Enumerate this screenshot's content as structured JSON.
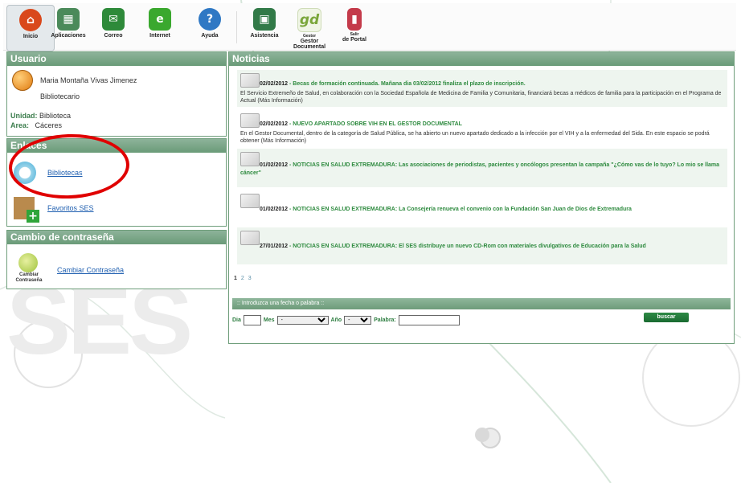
{
  "toolbar": {
    "items": [
      {
        "label": "Inicio",
        "icon": "home-icon",
        "color": "#d9481b"
      },
      {
        "label": "Aplicaciones",
        "icon": "apps-icon",
        "color": "#4b8a5a"
      },
      {
        "label": "Correo",
        "icon": "mail-icon",
        "color": "#2e8a3a"
      },
      {
        "label": "Internet",
        "icon": "internet-icon",
        "color": "#3aa82e"
      },
      {
        "label": "Ayuda",
        "icon": "help-icon",
        "color": "#2f78c4"
      },
      {
        "label": "Asistencia",
        "icon": "support-icon",
        "color": "#327a48"
      },
      {
        "label": "Gestor Documental",
        "icon": "gd-icon",
        "color": "#7aa63a"
      },
      {
        "label": "de Portal",
        "icon": "portal-icon",
        "color": "#c43a4a"
      }
    ],
    "gd_text": "gd",
    "gd_sub": "Gestor",
    "portal_sub": "Salir"
  },
  "user": {
    "header": "Usuario",
    "name": "Maria Montaña Vivas Jimenez",
    "role": "Bibliotecario",
    "unidad_label": "Unidad:",
    "unidad_value": "Biblioteca",
    "area_label": "Area:",
    "area_value": "Cáceres"
  },
  "links": {
    "header": "Enlaces",
    "items": [
      {
        "label": "Bibliotecas"
      },
      {
        "label": "Favoritos SES"
      }
    ]
  },
  "password": {
    "header": "Cambio de contraseña",
    "caption": "Cambiar Contraseña",
    "link": "Cambiar Contraseña"
  },
  "news": {
    "header": "Noticias",
    "items": [
      {
        "date": "02/02/2012",
        "title": "Becas de formación continuada. Mañana dia 03/02/2012 finaliza el plazo de inscripción.",
        "body": "El Servicio Extremeño de Salud, en colaboración con la Sociedad Española de Medicina de Familia y Comunitaria, financiará becas a médicos de familia para la participación en el Programa de Actual (Más Información)"
      },
      {
        "date": "02/02/2012",
        "title": "NUEVO APARTADO SOBRE VIH EN EL GESTOR DOCUMENTAL",
        "body": "En el Gestor Documental, dentro de la categoría de Salud Pública, se ha abierto un nuevo apartado dedicado a la infección por el VIH y a la enfermedad del Sida. En este espacio se podrá obtener (Más Información)"
      },
      {
        "date": "01/02/2012",
        "title": "NOTICIAS EN SALUD EXTREMADURA: Las asociaciones de periodistas, pacientes y oncólogos presentan la campaña \"¿Cómo vas de lo tuyo? Lo mio se llama cáncer\"",
        "body": ""
      },
      {
        "date": "01/02/2012",
        "title": "NOTICIAS EN SALUD EXTREMADURA: La Consejería renueva el convenio con la Fundación San Juan de Dios de Extremadura",
        "body": ""
      },
      {
        "date": "27/01/2012",
        "title": "NOTICIAS EN SALUD EXTREMADURA: El SES distribuye un nuevo CD-Rom con materiales divulgativos de Educación para la Salud",
        "body": ""
      }
    ],
    "pages": [
      "1",
      "2",
      "3"
    ],
    "search_header": ":: Introduzca una fecha o palabra ::",
    "dia_label": "Dia",
    "mes_label": "Mes",
    "mes_value": "-",
    "anio_label": "Año",
    "anio_value": "-",
    "palabra_label": "Palabra:",
    "search_button": "buscar"
  },
  "background": {
    "watermark": "SES"
  }
}
